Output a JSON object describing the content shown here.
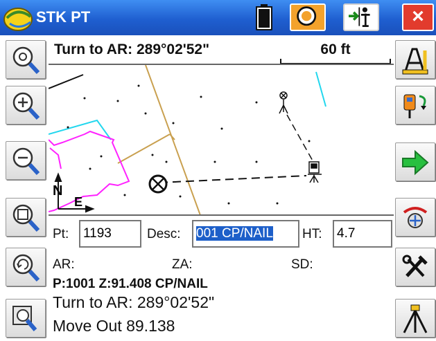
{
  "window": {
    "title": "STK PT",
    "close_label": "×"
  },
  "header": {
    "instruction": "Turn to AR: 289°02'52\"",
    "scale": "60 ft"
  },
  "map": {
    "north_label": "N",
    "east_label": "E"
  },
  "inputs": {
    "pt_label": "Pt:",
    "pt_value": "1193",
    "desc_label": "Desc:",
    "desc_value": "001 CP/NAIL",
    "ht_label": "HT:",
    "ht_value": "4.7"
  },
  "readouts": {
    "ar_label": "AR:",
    "za_label": "ZA:",
    "sd_label": "SD:",
    "point_line": "P:1001 Z:91.408 CP/NAIL",
    "turn_line": "Turn to AR: 289°02'52\"",
    "move_line": "Move Out 89.138"
  },
  "colors": {
    "titlebar": "#2568d8",
    "gps_button": "#f3a22c",
    "close_button": "#e23b2d",
    "selection": "#1d5fc9",
    "boundary_magenta": "#ff22ff",
    "boundary_cyan": "#22d7ee",
    "boundary_tan": "#c9a04f",
    "arrow_green": "#28c040"
  },
  "icons": {
    "left_tools": [
      "zoom-extents-icon",
      "zoom-in-icon",
      "zoom-out-icon",
      "zoom-window-icon",
      "zoom-previous-icon",
      "zoom-settings-icon"
    ],
    "right_tools": [
      "cad-measure-icon",
      "instrument-setup-icon",
      "next-arrow-icon",
      "stakeout-options-icon",
      "tools-icon",
      "tripod-icon"
    ]
  }
}
